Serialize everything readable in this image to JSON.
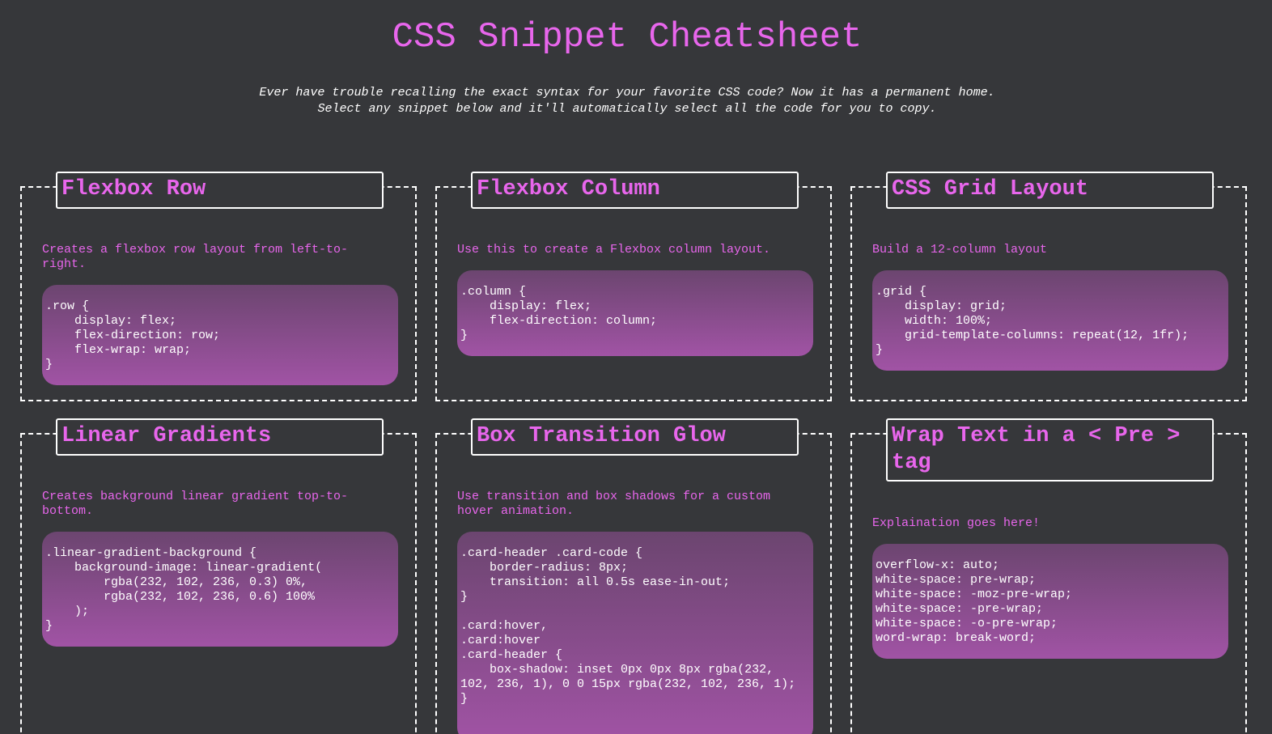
{
  "page": {
    "title": "CSS Snippet Cheatsheet",
    "intro_line1": "Ever have trouble recalling the exact syntax for your favorite CSS code? Now it has a permanent home.",
    "intro_line2": "Select any snippet below and it'll automatically select all the code for you to copy."
  },
  "colors": {
    "background": "#36373a",
    "accent": "#e866ec",
    "text": "#ffffff"
  },
  "cards": [
    {
      "title": "Flexbox Row",
      "description": "Creates a flexbox row layout from left-to-right.",
      "code": ".row {\n    display: flex;\n    flex-direction: row;\n    flex-wrap: wrap;\n}"
    },
    {
      "title": "Flexbox Column",
      "description": "Use this to create a Flexbox column layout.",
      "code": ".column {\n    display: flex;\n    flex-direction: column;\n}"
    },
    {
      "title": "CSS Grid Layout",
      "description": "Build a 12-column layout",
      "code": ".grid {\n    display: grid;\n    width: 100%;\n    grid-template-columns: repeat(12, 1fr);\n}"
    },
    {
      "title": "Linear Gradients",
      "description": "Creates background linear gradient top-to-bottom.",
      "code": ".linear-gradient-background {\n    background-image: linear-gradient(\n        rgba(232, 102, 236, 0.3) 0%,\n        rgba(232, 102, 236, 0.6) 100%\n    );\n}"
    },
    {
      "title": "Box Transition Glow",
      "description": "Use transition and box shadows for a custom hover animation.",
      "code": ".card-header .card-code {\n    border-radius: 8px;\n    transition: all 0.5s ease-in-out;\n}\n\n.card:hover,\n.card:hover\n.card-header {\n    box-shadow: inset 0px 0px 8px rgba(232, 102, 236, 1), 0 0 15px rgba(232, 102, 236, 1);\n}"
    },
    {
      "title": "Wrap Text in a < Pre > tag",
      "description": "Explaination goes here!",
      "code": "overflow-x: auto;\nwhite-space: pre-wrap;\nwhite-space: -moz-pre-wrap;\nwhite-space: -pre-wrap;\nwhite-space: -o-pre-wrap;\nword-wrap: break-word;"
    }
  ]
}
